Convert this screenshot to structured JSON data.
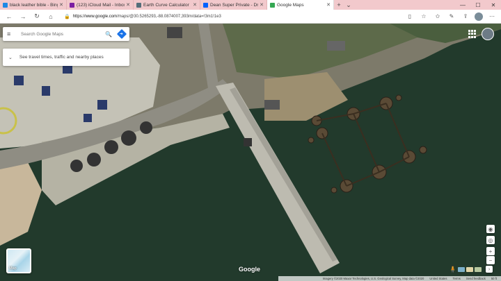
{
  "browser": {
    "tabs": [
      {
        "label": "black leather bible - Bing im",
        "fav_color": "#1e88e5"
      },
      {
        "label": "(123) iCloud Mail - Inbox (2",
        "fav_color": "#7b1fa2"
      },
      {
        "label": "Earth Curve Calculator",
        "fav_color": "#546e7a"
      },
      {
        "label": "Dean Super Private - Dropb",
        "fav_color": "#0061fe"
      },
      {
        "label": "Google Maps",
        "fav_color": "#34a853"
      }
    ],
    "new_tab": "+",
    "url_host": "https://www.google.com",
    "url_path": "/maps/@30.5265293,-88.0874007,393m/data=!3m1!1e3",
    "win_controls": [
      "—",
      "☐",
      "✕"
    ]
  },
  "maps": {
    "search_placeholder": "Search Google Maps",
    "travel_text": "See travel times, traffic and nearby places",
    "layer_label": "Map",
    "logo": "Google",
    "attribution": {
      "imagery": "Imagery ©2020 Maxar Technologies, U.S. Geological Survey, Map data ©2020",
      "country": "United States",
      "terms": "Terms",
      "feedback": "Send feedback",
      "scale": "50 ft"
    }
  },
  "icons": {
    "back": "←",
    "forward": "→",
    "refresh": "↻",
    "home": "⌂",
    "menu": "≡",
    "search": "🔍",
    "chevron": "⌄",
    "compass": "◉",
    "zoom_in": "+",
    "zoom_out": "−",
    "pegman": "🧍"
  }
}
